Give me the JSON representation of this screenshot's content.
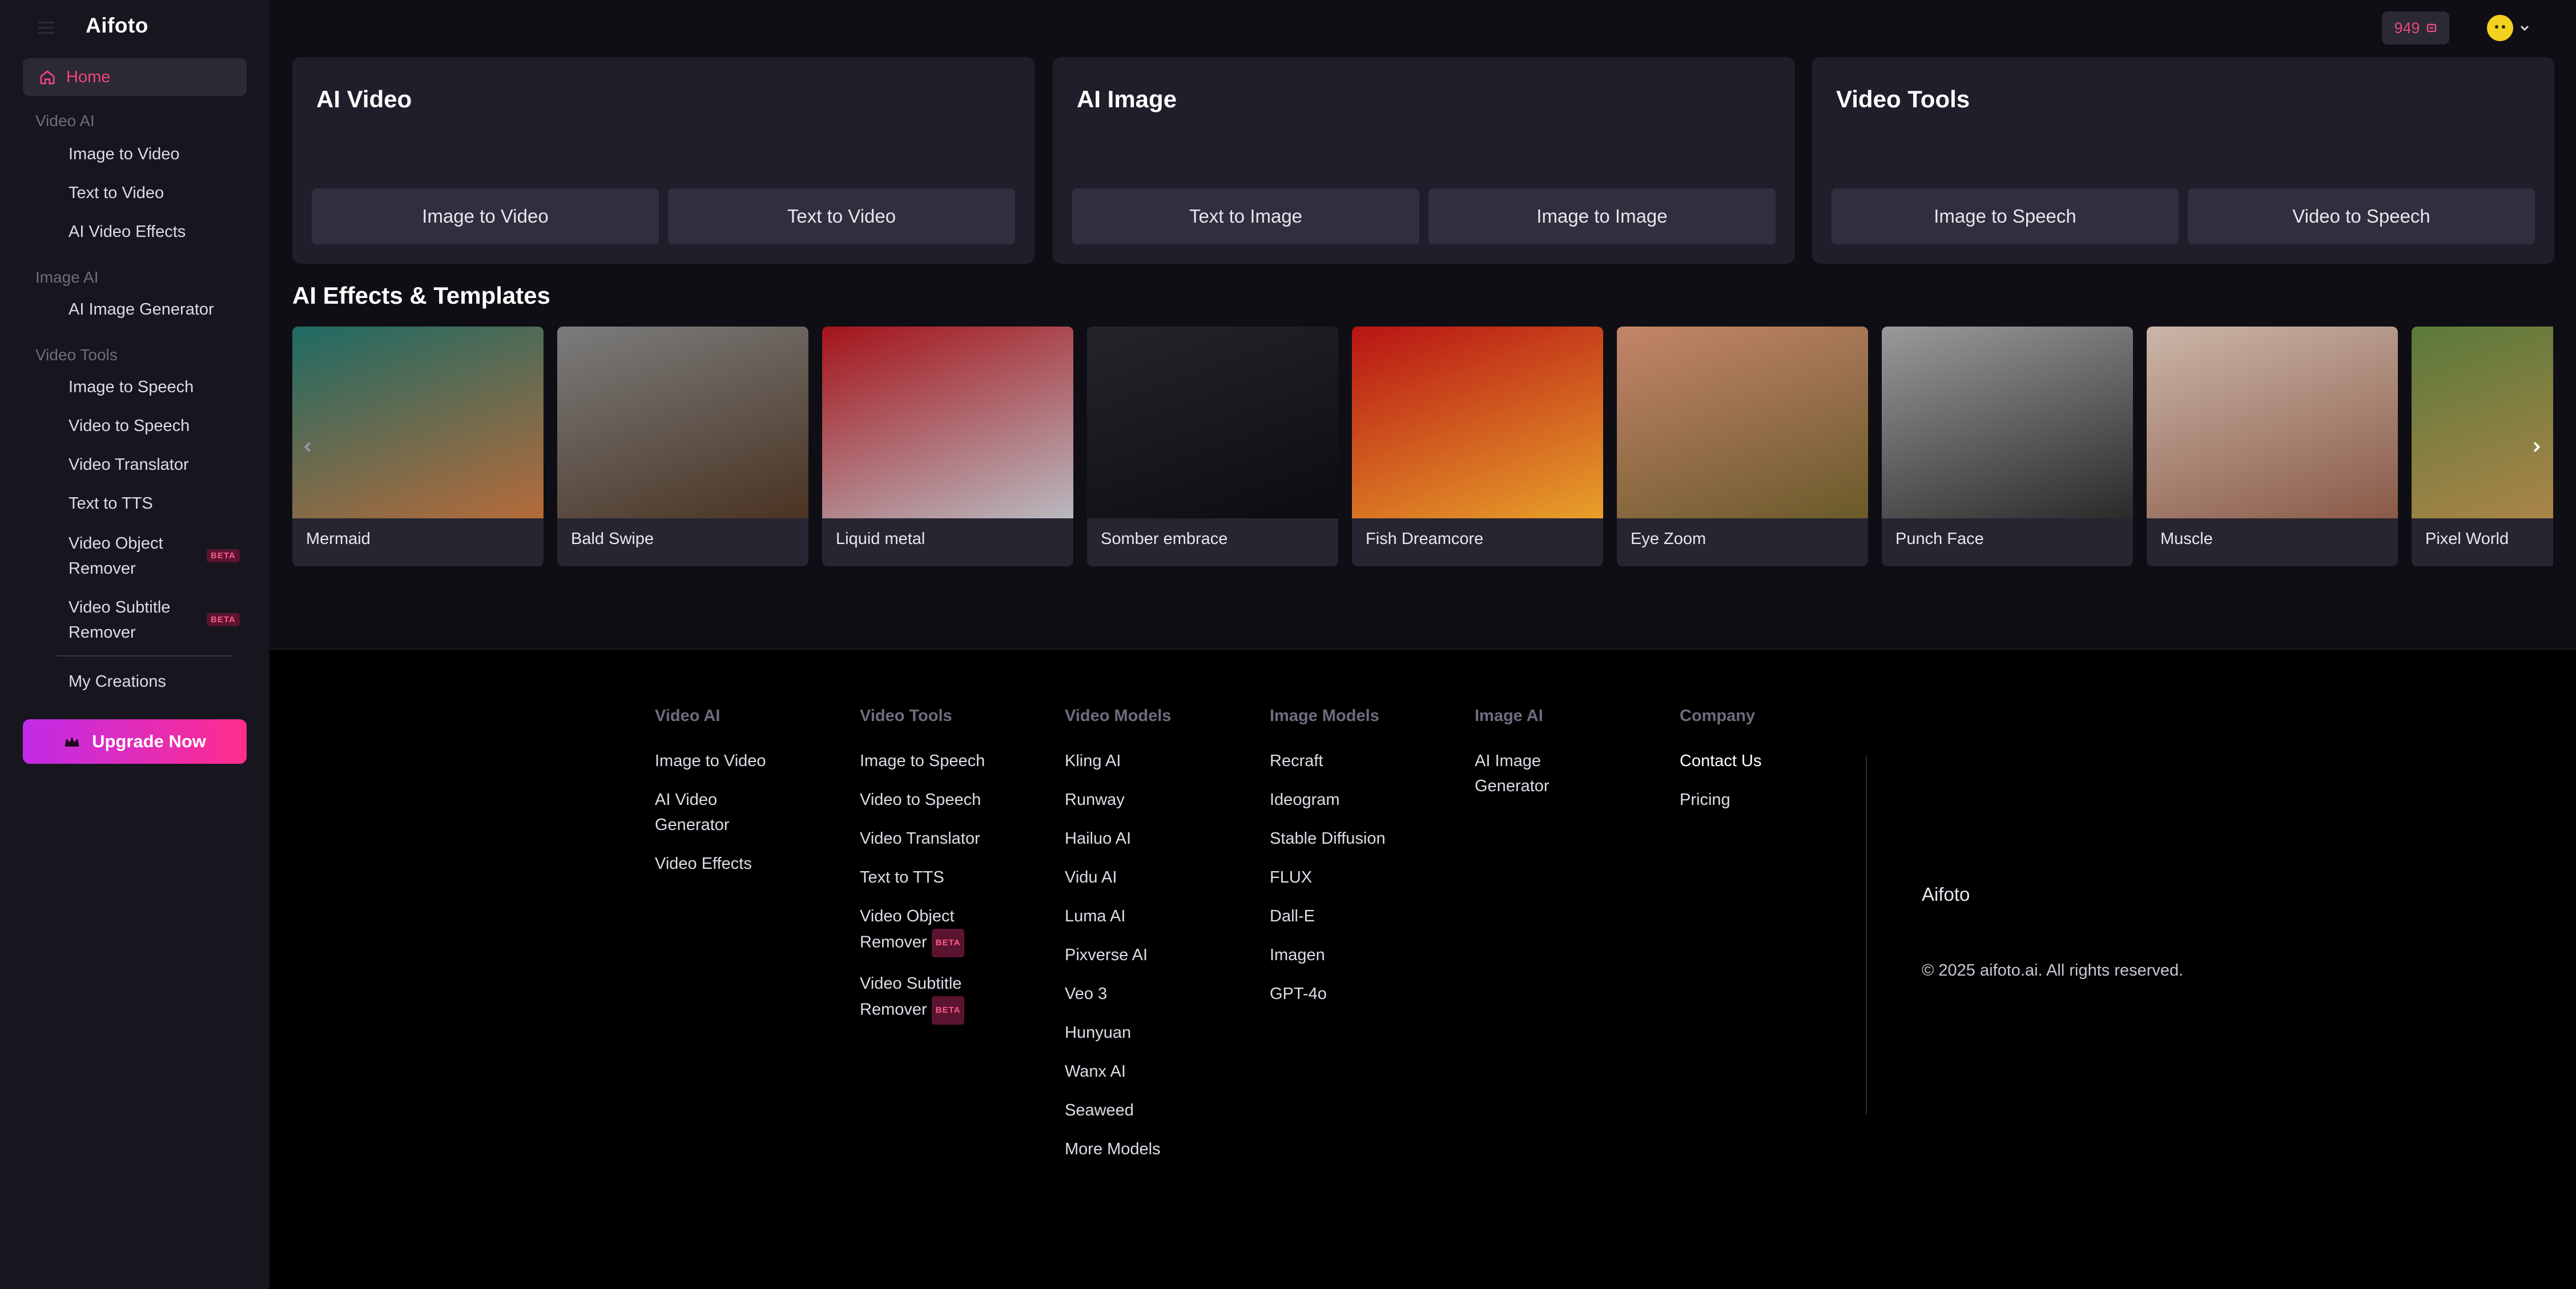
{
  "app": {
    "logo": "Aifoto"
  },
  "sidebar": {
    "home": "Home",
    "sections": [
      {
        "title": "Video AI",
        "items": [
          {
            "label": "Image to Video"
          },
          {
            "label": "Text to Video"
          },
          {
            "label": "AI Video Effects"
          }
        ]
      },
      {
        "title": "Image AI",
        "items": [
          {
            "label": "AI Image Generator"
          }
        ]
      },
      {
        "title": "Video Tools",
        "items": [
          {
            "label": "Image to Speech"
          },
          {
            "label": "Video to Speech"
          },
          {
            "label": "Video Translator"
          },
          {
            "label": "Text to TTS"
          },
          {
            "label": "Video Object",
            "label2": "Remover",
            "badge": "BETA"
          },
          {
            "label": "Video Subtitle",
            "label2": "Remover",
            "badge": "BETA"
          }
        ]
      }
    ],
    "my_creations": "My Creations",
    "upgrade": "Upgrade Now"
  },
  "topbar": {
    "credits": "949"
  },
  "cards": [
    {
      "title": "AI Video",
      "buttons": [
        "Image to Video",
        "Text to Video"
      ]
    },
    {
      "title": "AI Image",
      "buttons": [
        "Text to Image",
        "Image to Image"
      ]
    },
    {
      "title": "Video Tools",
      "buttons": [
        "Image to Speech",
        "Video to Speech"
      ]
    }
  ],
  "effects": {
    "title": "AI Effects & Templates",
    "items": [
      {
        "label": "Mermaid",
        "colors": [
          "#1e6b64",
          "#b56b3a"
        ]
      },
      {
        "label": "Bald Swipe",
        "colors": [
          "#7b7c7c",
          "#4a3322"
        ]
      },
      {
        "label": "Liquid metal",
        "colors": [
          "#a4141a",
          "#b9b9c0"
        ]
      },
      {
        "label": "Somber embrace",
        "colors": [
          "#262428",
          "#0c0c10"
        ]
      },
      {
        "label": "Fish Dreamcore",
        "colors": [
          "#b81414",
          "#e8a02a"
        ]
      },
      {
        "label": "Eye Zoom",
        "colors": [
          "#c4856a",
          "#6a5a2a"
        ]
      },
      {
        "label": "Punch Face",
        "colors": [
          "#9a9a9a",
          "#2a2a2a"
        ]
      },
      {
        "label": "Muscle",
        "colors": [
          "#cbb6a8",
          "#8a5a48"
        ]
      },
      {
        "label": "Pixel World",
        "colors": [
          "#5a7a3a",
          "#b8864a"
        ]
      }
    ]
  },
  "footer": {
    "columns": [
      {
        "title": "Video AI",
        "links": [
          {
            "label": "Image to Video"
          },
          {
            "label": "AI Video",
            "label2": "Generator"
          },
          {
            "label": "Video Effects"
          }
        ]
      },
      {
        "title": "Video Tools",
        "links": [
          {
            "label": "Image to Speech"
          },
          {
            "label": "Video to Speech"
          },
          {
            "label": "Video Translator"
          },
          {
            "label": "Text to TTS"
          },
          {
            "label": "Video Object",
            "label2": "Remover",
            "badge": "BETA"
          },
          {
            "label": "Video Subtitle",
            "label2": "Remover",
            "badge": "BETA"
          }
        ]
      },
      {
        "title": "Video Models",
        "links": [
          {
            "label": "Kling AI"
          },
          {
            "label": "Runway"
          },
          {
            "label": "Hailuo AI"
          },
          {
            "label": "Vidu AI"
          },
          {
            "label": "Luma AI"
          },
          {
            "label": "Pixverse AI"
          },
          {
            "label": "Veo 3"
          },
          {
            "label": "Hunyuan"
          },
          {
            "label": "Wanx AI"
          },
          {
            "label": "Seaweed"
          },
          {
            "label": "More Models"
          }
        ]
      },
      {
        "title": "Image Models",
        "links": [
          {
            "label": "Recraft"
          },
          {
            "label": "Ideogram"
          },
          {
            "label": "Stable Diffusion"
          },
          {
            "label": "FLUX"
          },
          {
            "label": "Dall-E"
          },
          {
            "label": "Imagen"
          },
          {
            "label": "GPT-4o"
          }
        ]
      },
      {
        "title": "Image AI",
        "links": [
          {
            "label": "AI Image",
            "label2": "Generator"
          }
        ]
      },
      {
        "title": "Company",
        "links": [
          {
            "label": "Contact Us"
          },
          {
            "label": "Pricing"
          }
        ]
      }
    ],
    "brand": "Aifoto",
    "copyright": "© 2025 aifoto.ai. All rights reserved."
  },
  "colors": {
    "accent": "#f0457c",
    "upgrade_start": "#c02be8",
    "upgrade_end": "#ff2d8c"
  }
}
